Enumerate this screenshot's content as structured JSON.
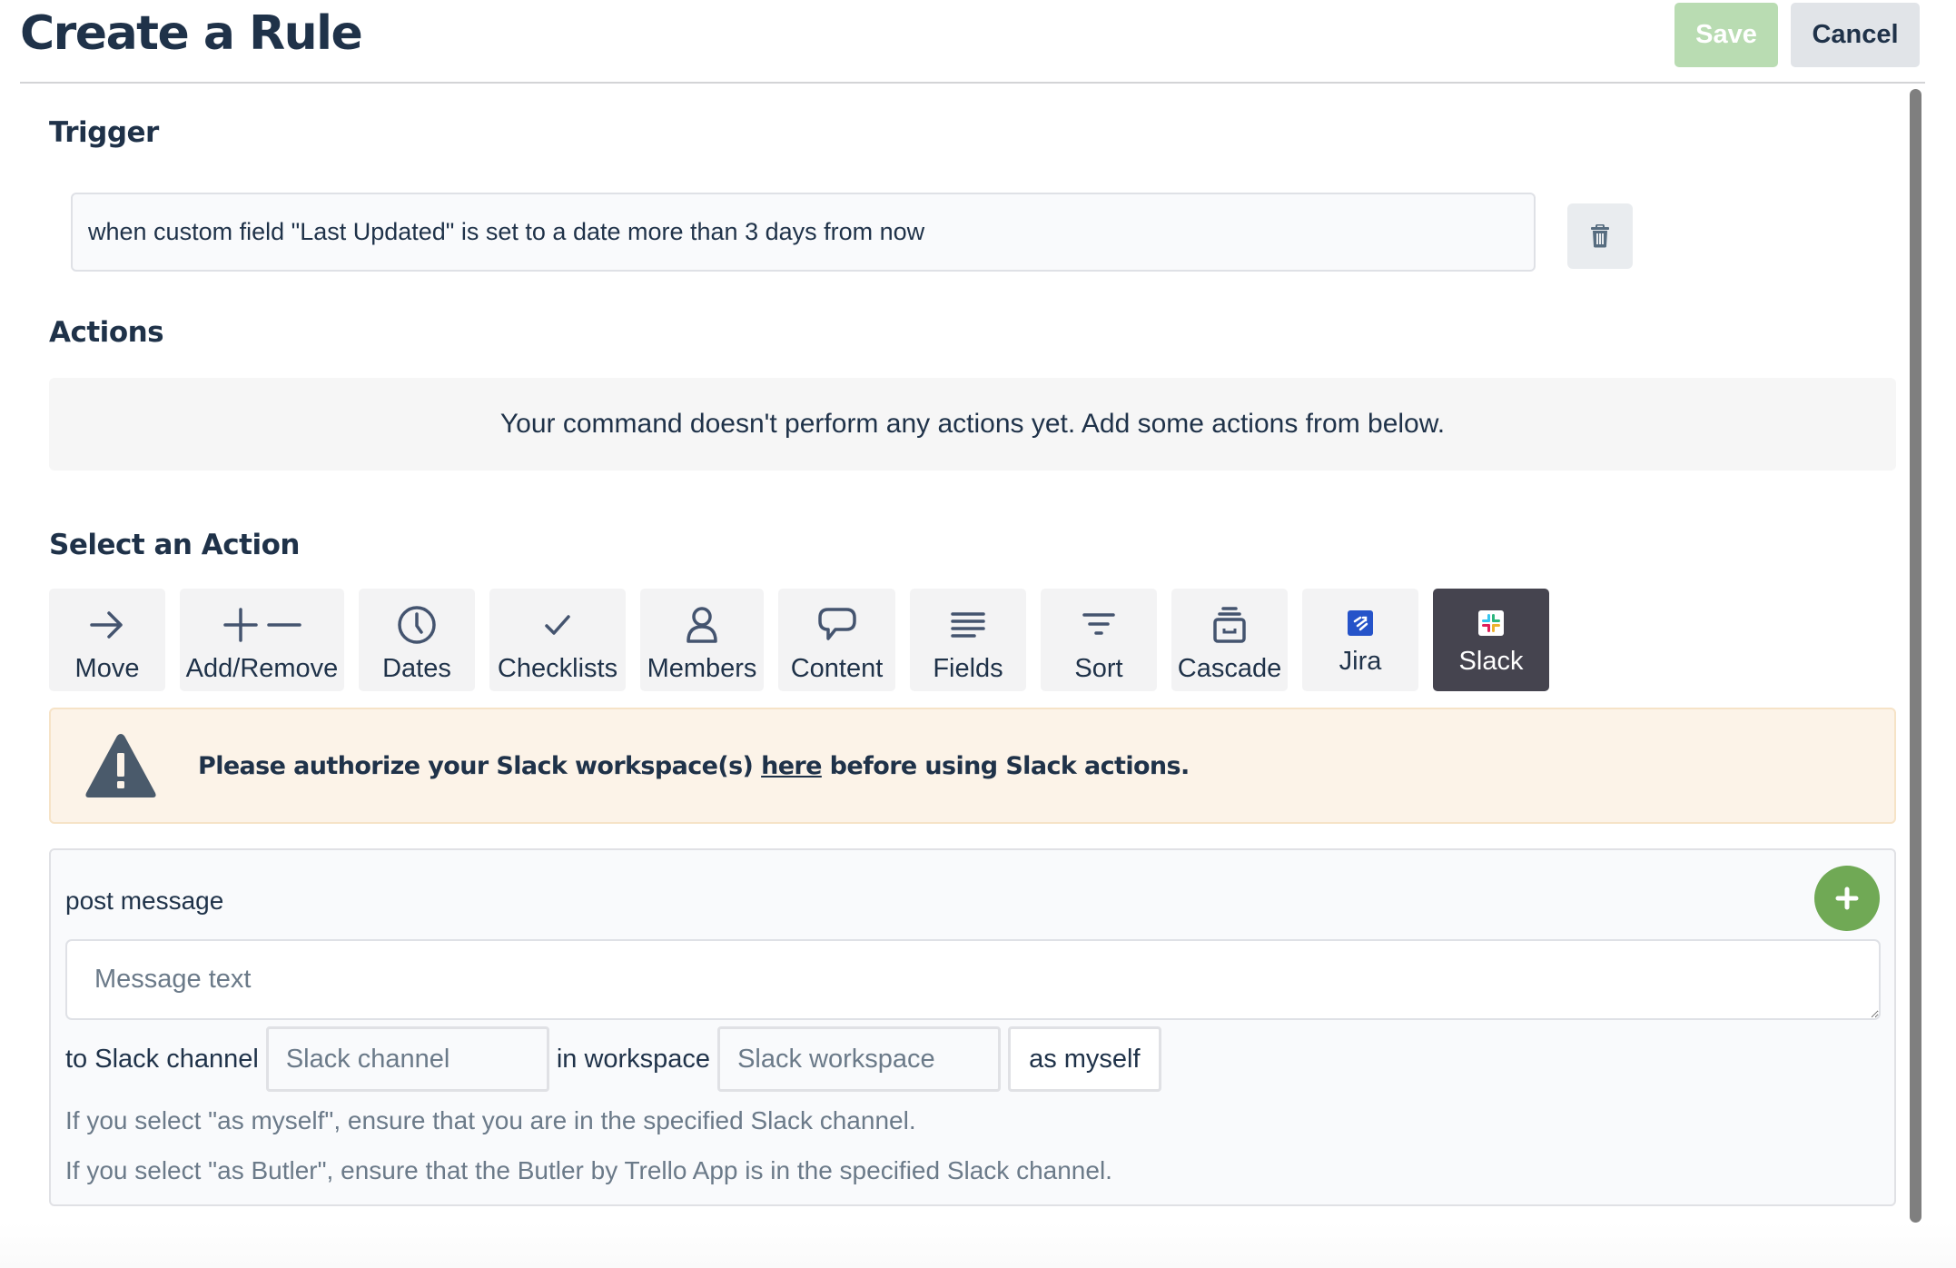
{
  "header": {
    "title": "Create a Rule",
    "save_label": "Save",
    "cancel_label": "Cancel"
  },
  "trigger": {
    "heading": "Trigger",
    "text": "when custom field \"Last Updated\" is set to a date more than 3 days from now",
    "delete_icon": "trash-icon"
  },
  "actions": {
    "heading": "Actions",
    "empty_message": "Your command doesn't perform any actions yet. Add some actions from below."
  },
  "select_action": {
    "heading": "Select an Action",
    "items": [
      {
        "label": "Move",
        "icon": "arrow-right-icon",
        "active": false
      },
      {
        "label": "Add/Remove",
        "icon": "plus-minus-icon",
        "active": false
      },
      {
        "label": "Dates",
        "icon": "clock-icon",
        "active": false
      },
      {
        "label": "Checklists",
        "icon": "checkmark-icon",
        "active": false
      },
      {
        "label": "Members",
        "icon": "person-icon",
        "active": false
      },
      {
        "label": "Content",
        "icon": "speech-bubble-icon",
        "active": false
      },
      {
        "label": "Fields",
        "icon": "lines-icon",
        "active": false
      },
      {
        "label": "Sort",
        "icon": "filter-icon",
        "active": false
      },
      {
        "label": "Cascade",
        "icon": "archive-box-icon",
        "active": false
      },
      {
        "label": "Jira",
        "icon": "jira-logo-icon",
        "active": false
      },
      {
        "label": "Slack",
        "icon": "slack-logo-icon",
        "active": true
      }
    ]
  },
  "warning": {
    "icon": "warning-triangle-icon",
    "text_before": "Please authorize your Slack workspace(s) ",
    "link_text": "here",
    "text_after": " before using Slack actions."
  },
  "post_message": {
    "label": "post message",
    "add_icon": "plus-circle-icon",
    "message_placeholder": "Message text",
    "message_value": "",
    "to_channel_label": "to Slack channel",
    "channel_placeholder": "Slack channel",
    "in_workspace_label": "in workspace",
    "workspace_placeholder": "Slack workspace",
    "as_selection": "as myself",
    "hint_myself": "If you select \"as myself\", ensure that you are in the specified Slack channel.",
    "hint_butler": "If you select \"as Butler\", ensure that the Butler by Trello App is in the specified Slack channel."
  },
  "colors": {
    "primary_text": "#1f3249",
    "save_disabled": "#b9dcb2",
    "add_green": "#70a955",
    "active_tab": "#45444f",
    "warning_bg": "#fcf3e8",
    "jira_blue": "#2553c9"
  }
}
